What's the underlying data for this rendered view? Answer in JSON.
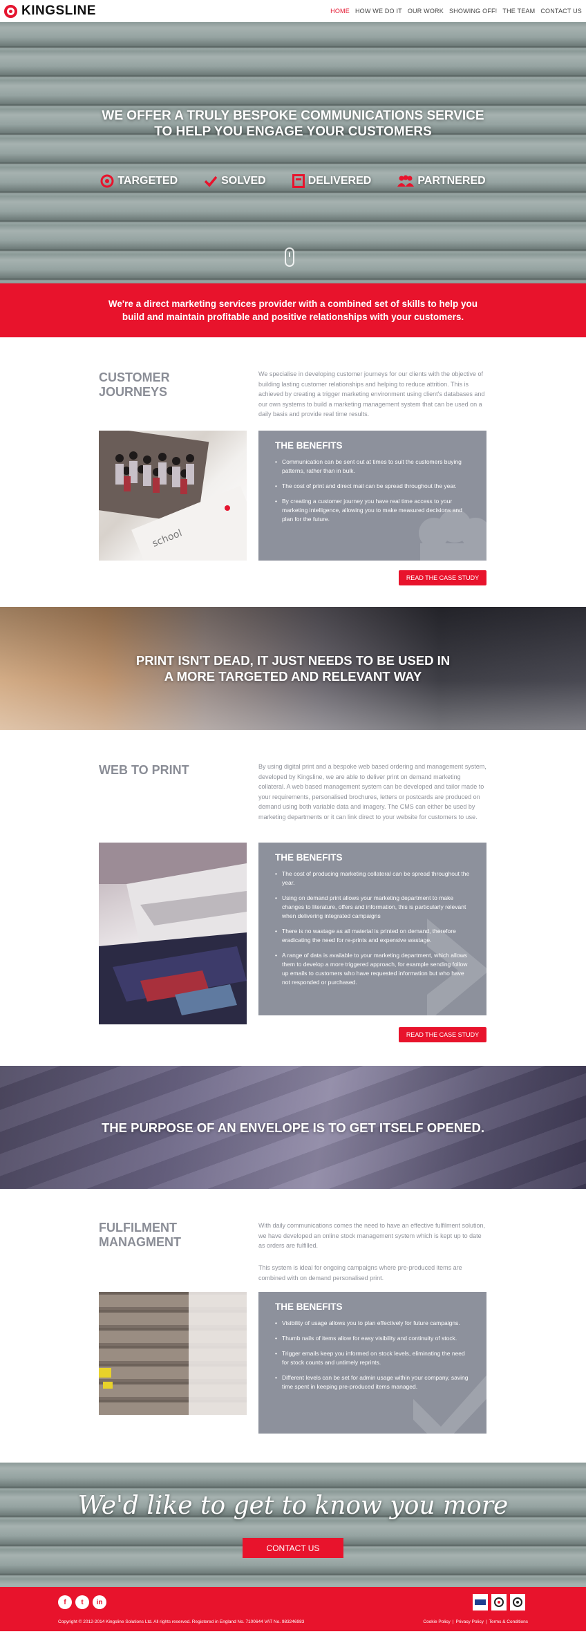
{
  "brand": {
    "name": "KINGSLINE"
  },
  "nav": {
    "items": [
      "HOME",
      "HOW WE DO IT",
      "OUR WORK",
      "SHOWING OFF!",
      "THE TEAM",
      "CONTACT US"
    ],
    "active": "HOME"
  },
  "hero": {
    "title": "WE OFFER A TRULY BESPOKE COMMUNICATIONS SERVICE TO HELP YOU ENGAGE YOUR CUSTOMERS",
    "features": [
      {
        "label": "TARGETED",
        "icon": "target-icon"
      },
      {
        "label": "SOLVED",
        "icon": "checkmark-icon"
      },
      {
        "label": "DELIVERED",
        "icon": "package-icon"
      },
      {
        "label": "PARTNERED",
        "icon": "people-icon"
      }
    ]
  },
  "intro_band": {
    "text": "We're a direct marketing services provider with a combined set of skills to help you build and maintain profitable and positive relationships with your customers."
  },
  "sections": [
    {
      "title": "CUSTOMER JOURNEYS",
      "intro": "We specialise in developing customer journeys for our clients with the objective of building lasting customer relationships and helping to reduce attrition. This is achieved by creating a trigger marketing environment using client's databases and our own systems to build a marketing management system that can be used on a daily basis and provide real time results.",
      "benefits_title": "THE BENEFITS",
      "benefits": [
        "Communication can be sent out at times to suit the customers buying patterns, rather than in bulk.",
        "The cost of print and direct mail can be spread throughout the year.",
        "By creating a customer journey you have real time access to your marketing intelligence, allowing you to make measured decisions and plan for the future."
      ],
      "button": "READ THE CASE STUDY"
    },
    {
      "title": "WEB TO PRINT",
      "intro": "By using digital print and a bespoke web based ordering and management system, developed by Kingsline, we are able to deliver print on demand marketing collateral. A web based management system can be developed and tailor made to your requirements, personalised brochures, letters or postcards are produced on demand using both variable data and imagery. The CMS can either be used by marketing departments or it can link direct to your website for customers to use.",
      "benefits_title": "THE BENEFITS",
      "benefits": [
        "The cost of producing marketing collateral can be spread throughout the year.",
        "Using on demand print allows your marketing department to make changes to literature, offers and information, this is particularly relevant when delivering integrated campaigns",
        "There is no wastage as all material is printed on demand, therefore eradicating the need for re-prints and expensive wastage.",
        "A range of data is available to your marketing department, which allows them to develop a more triggered approach, for example sending follow up emails to customers who have requested information but who have not responded or purchased."
      ],
      "button": "READ THE CASE STUDY"
    },
    {
      "title": "FULFILMENT MANAGMENT",
      "intro": "With daily communications comes the need to have an effective fulfilment solution, we have developed an online stock management system which is kept up to date as orders are fulfilled.",
      "intro2": "This system is ideal for ongoing campaigns where pre-produced items are combined with on demand personalised print.",
      "benefits_title": "THE BENEFITS",
      "benefits": [
        "Visibility of usage allows you to plan effectively for future campaigns.",
        "Thumb nails of items allow for easy visibility and continuity of stock.",
        "Trigger emails keep you informed on stock levels, eliminating the need for stock counts and untimely reprints.",
        "Different levels can be set for admin usage within your company, saving time spent in keeping pre-produced items managed."
      ]
    }
  ],
  "quotes": [
    "PRINT ISN'T DEAD, IT JUST NEEDS TO BE USED IN A MORE TARGETED AND RELEVANT WAY",
    "THE PURPOSE OF AN ENVELOPE IS TO GET ITSELF OPENED."
  ],
  "contact_band": {
    "tagline": "We'd like to get to know you more",
    "button": "CONTACT US"
  },
  "footer": {
    "socials": [
      "f",
      "t",
      "in"
    ],
    "copyright": "Copyright © 2012-2014 Kingsline Solutions Ltd. All rights reserved. Registered in England No. 7100644 VAT No. 983246983",
    "links": [
      "Cookie Policy",
      "Privacy Policy",
      "Terms & Conditions"
    ]
  },
  "colors": {
    "accent": "#e8132c",
    "panel": "#8d919c",
    "text": "#8a8d96"
  }
}
